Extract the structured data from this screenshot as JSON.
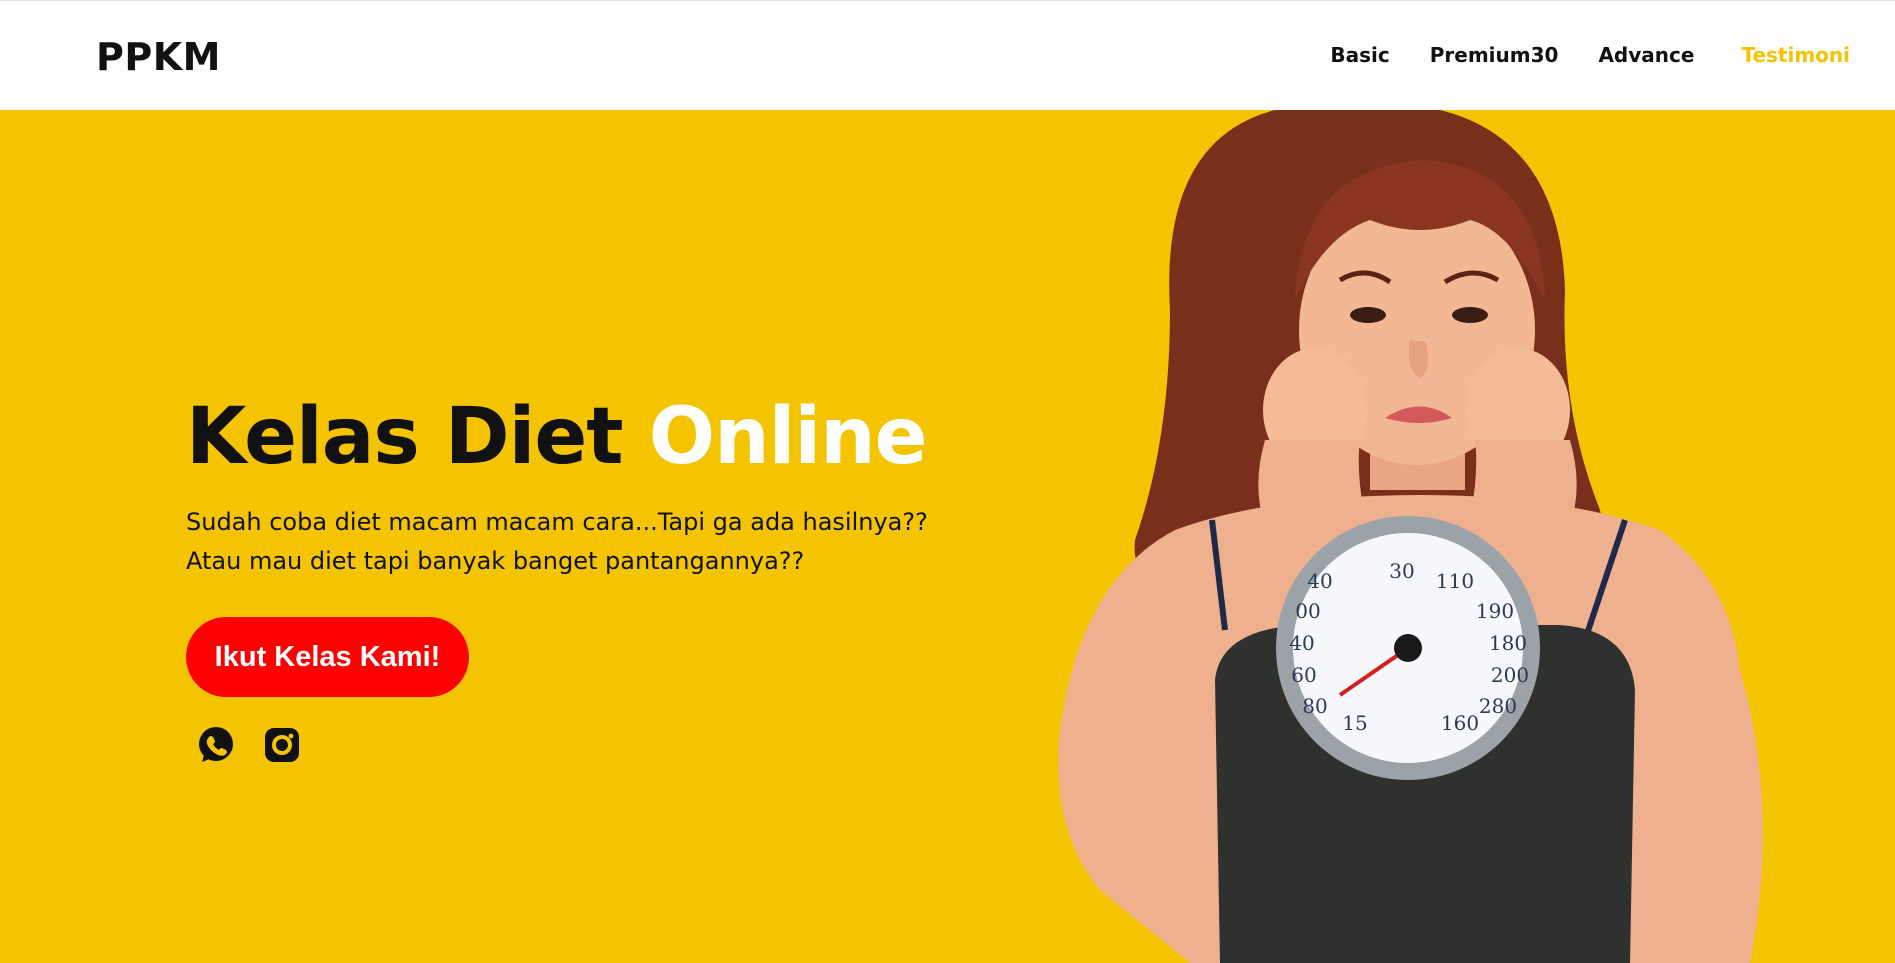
{
  "brand": {
    "logo": "PPKM"
  },
  "nav": {
    "items": [
      {
        "label": "Basic"
      },
      {
        "label": "Premium30"
      },
      {
        "label": "Advance"
      },
      {
        "label": "Testimoni"
      }
    ]
  },
  "hero": {
    "title_part1": "Kelas Diet",
    "title_part2": "Online",
    "subtitle_line1": "Sudah coba diet macam macam cara...Tapi ga ada hasilnya??",
    "subtitle_line2": "Atau mau diet tapi banyak banget pantangannya??",
    "cta_label": "Ikut Kelas Kami!"
  },
  "scale": {
    "left_numbers": [
      "40",
      "00",
      "40",
      "60",
      "80",
      "15"
    ],
    "top_numbers": [
      "30",
      "110"
    ],
    "right_numbers": [
      "190",
      "180",
      "200",
      "280",
      "160"
    ]
  },
  "icons": {
    "social": [
      "whatsapp-icon",
      "instagram-icon"
    ]
  },
  "colors": {
    "hero_background": "#f5c400",
    "cta_background": "#ff0000",
    "active_nav": "#f5c300",
    "text_dark": "#111111"
  }
}
